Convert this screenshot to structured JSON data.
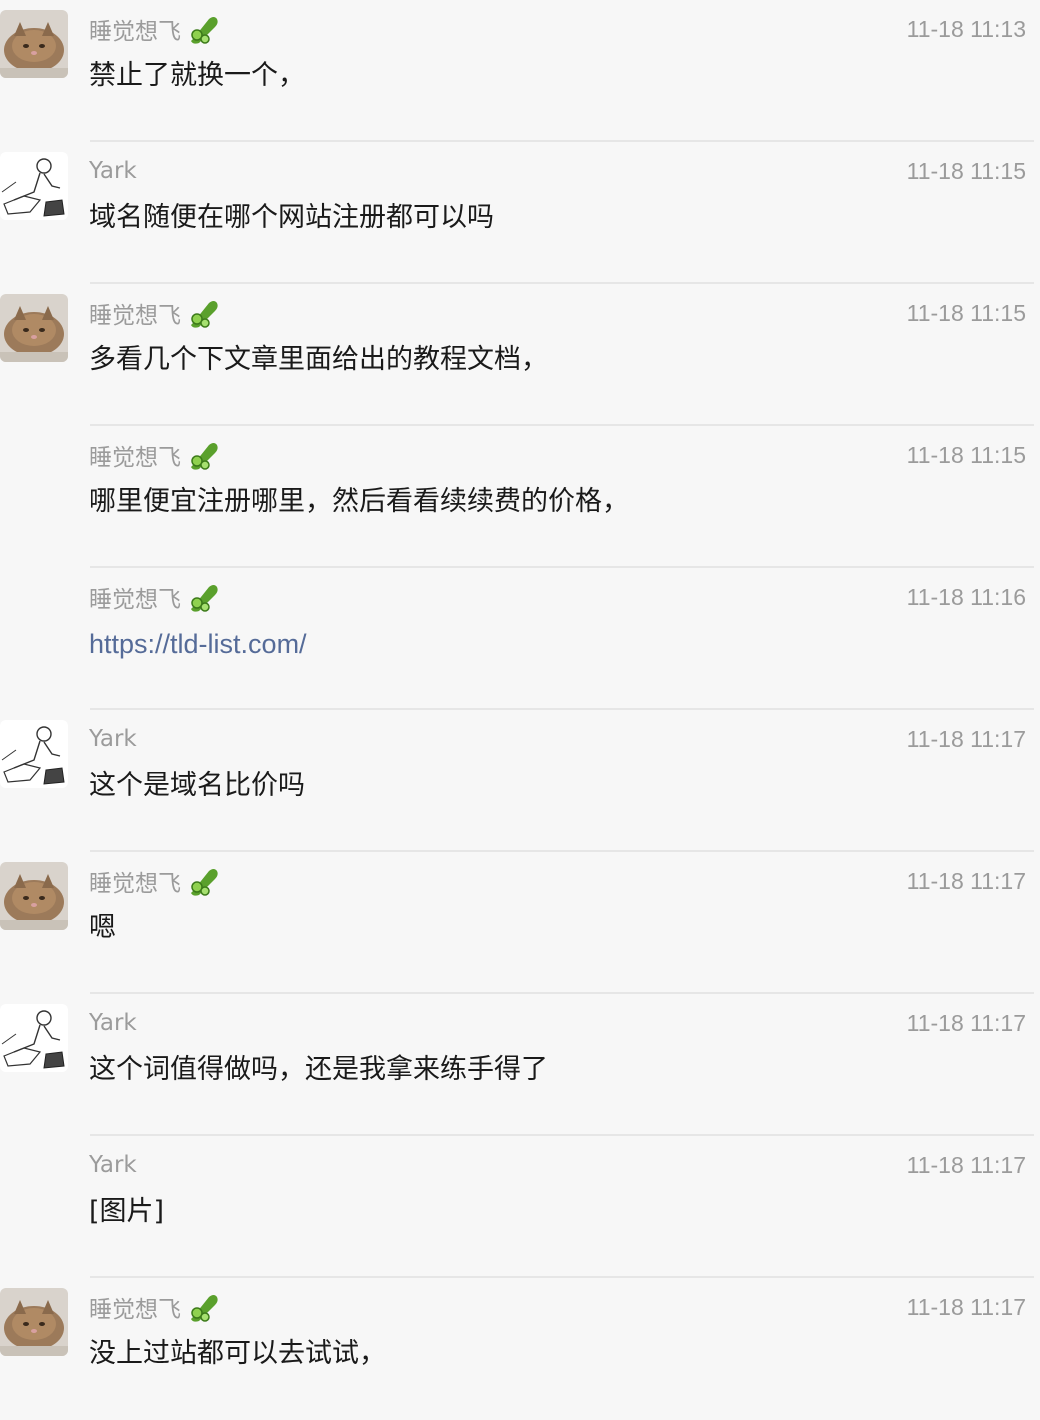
{
  "colors": {
    "background": "#f7f7f7",
    "meta_text": "#9b9b9b",
    "message_text": "#1a1a1a",
    "link": "#556b98",
    "divider": "#e6e6e6"
  },
  "messages": [
    {
      "sender": "睡觉想飞",
      "avatar": "cat-avatar",
      "badge": "cucumber-icon",
      "time": "11-18 11:13",
      "text": "禁止了就换一个，",
      "link": false
    },
    {
      "sender": "Yark",
      "avatar": "sketch-avatar",
      "badge": "",
      "time": "11-18 11:15",
      "text": "域名随便在哪个网站注册都可以吗",
      "link": false
    },
    {
      "sender": "睡觉想飞",
      "avatar": "cat-avatar",
      "badge": "cucumber-icon",
      "time": "11-18 11:15",
      "text": "多看几个下文章里面给出的教程文档，",
      "link": false
    },
    {
      "sender": "睡觉想飞",
      "avatar": "",
      "badge": "cucumber-icon",
      "time": "11-18 11:15",
      "text": "哪里便宜注册哪里，然后看看续续费的价格，",
      "link": false
    },
    {
      "sender": "睡觉想飞",
      "avatar": "",
      "badge": "cucumber-icon",
      "time": "11-18 11:16",
      "text": "https://tld-list.com/",
      "link": true
    },
    {
      "sender": "Yark",
      "avatar": "sketch-avatar",
      "badge": "",
      "time": "11-18 11:17",
      "text": "这个是域名比价吗",
      "link": false
    },
    {
      "sender": "睡觉想飞",
      "avatar": "cat-avatar",
      "badge": "cucumber-icon",
      "time": "11-18 11:17",
      "text": "嗯",
      "link": false
    },
    {
      "sender": "Yark",
      "avatar": "sketch-avatar",
      "badge": "",
      "time": "11-18 11:17",
      "text": "这个词值得做吗，还是我拿来练手得了",
      "link": false
    },
    {
      "sender": "Yark",
      "avatar": "",
      "badge": "",
      "time": "11-18 11:17",
      "text": "[图片]",
      "link": false
    },
    {
      "sender": "睡觉想飞",
      "avatar": "cat-avatar",
      "badge": "cucumber-icon",
      "time": "11-18 11:17",
      "text": "没上过站都可以去试试，",
      "link": false
    }
  ]
}
